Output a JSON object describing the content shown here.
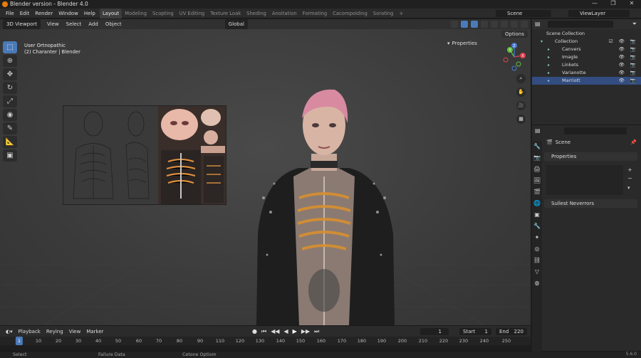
{
  "window": {
    "title": "Blender version - Blender 4.0",
    "controls": [
      "—",
      "❐",
      "✕"
    ]
  },
  "menu": [
    "File",
    "Edit",
    "Render",
    "Window",
    "Help"
  ],
  "workspace_tabs": [
    "Layout",
    "Modeling",
    "Scopting",
    "UV Editing",
    "Texture Loak",
    "Sheding",
    "Anoitation",
    "Formating",
    "Cacompoiding",
    "Sorating"
  ],
  "active_tab": "Layout",
  "add_tab": "+",
  "scene_field": "Scene",
  "viewlayer_field": "ViewLayer",
  "viewport_header": {
    "editor_type": "3D Viewport",
    "menus": [
      "View",
      "Select",
      "Add",
      "Object"
    ],
    "transform_orientation": "Global"
  },
  "viewport": {
    "mode_line": "User Ortnopathic",
    "object_line": "(2) Charanter | Blender",
    "options_label": "Options",
    "properties_label": "Properties",
    "gizmo_axes": [
      "X",
      "Y",
      "Z"
    ]
  },
  "toolbar_icons": [
    "select-cursor-icon",
    "cursor-icon",
    "move-icon",
    "rotate-icon",
    "scale-icon",
    "transform-icon",
    "annotate-icon",
    "measure-icon",
    "add-cube-icon"
  ],
  "timeline": {
    "menus": [
      "Playback",
      "Reying",
      "View",
      "Marker"
    ],
    "current_frame": "1",
    "start_label": "Start",
    "start_value": "1",
    "end_label": "End",
    "end_value": "220",
    "ruler": [
      "1",
      "10",
      "20",
      "30",
      "40",
      "50",
      "60",
      "70",
      "80",
      "90",
      "110",
      "120",
      "130",
      "140",
      "150",
      "160",
      "170",
      "180",
      "190",
      "200",
      "210",
      "220",
      "230",
      "240",
      "250"
    ]
  },
  "status": {
    "left": "Select",
    "middle": "Failure Data",
    "right": "Cetone Optiom",
    "version": "5.6.0"
  },
  "outliner": {
    "root": "Scene Collection",
    "collection": "Collection",
    "items": [
      {
        "name": "Canvers",
        "selected": false
      },
      {
        "name": "Imagle",
        "selected": false
      },
      {
        "name": "Linkets",
        "selected": false
      },
      {
        "name": "Varianotte",
        "selected": false
      },
      {
        "name": "Marriott",
        "selected": true
      }
    ]
  },
  "properties": {
    "scene_label": "Scene",
    "panel1": "Properties",
    "panel2": "Sullest Neverrors"
  },
  "colors": {
    "accent": "#4a7ab8",
    "selected_row": "#334d80",
    "orange": "#e87d0d"
  }
}
